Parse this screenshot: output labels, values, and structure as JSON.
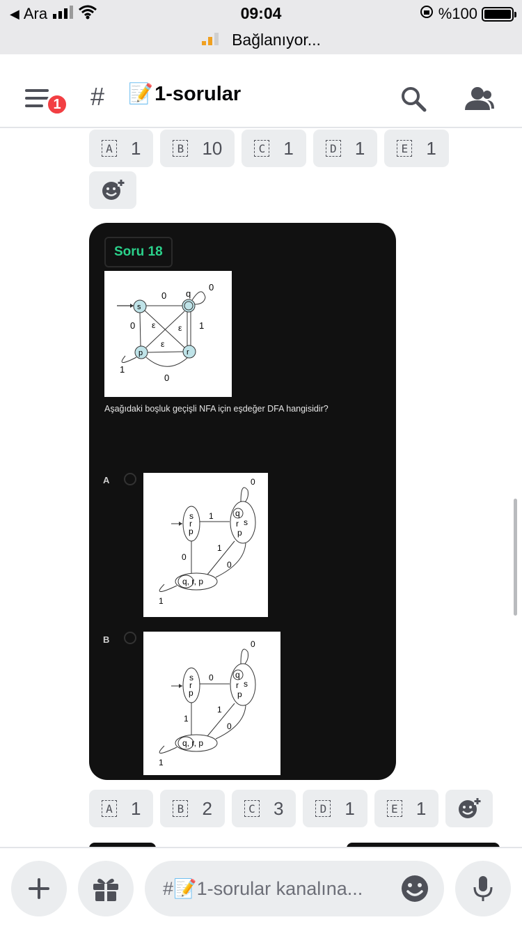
{
  "status": {
    "back_label": "Ara",
    "time": "09:04",
    "battery_text": "%100",
    "connecting_text": "Bağlanıyor..."
  },
  "header": {
    "badge_count": "1",
    "hash": "#",
    "channel_emoji": "📝",
    "channel_name": "1-sorular"
  },
  "reactions_top": [
    {
      "letter": "A",
      "count": "1"
    },
    {
      "letter": "B",
      "count": "10"
    },
    {
      "letter": "C",
      "count": "1"
    },
    {
      "letter": "D",
      "count": "1"
    },
    {
      "letter": "E",
      "count": "1"
    }
  ],
  "question": {
    "tag": "Soru 18",
    "text": "Aşağıdaki boşluk geçişli NFA için eşdeğer DFA hangisidir?",
    "option_a_label": "A",
    "option_b_label": "B",
    "nfa": {
      "s": "s",
      "q": "q",
      "r": "r",
      "p": "p",
      "zero": "0",
      "one": "1",
      "eps": "ε"
    },
    "opt_a": {
      "state1": [
        "s",
        "r",
        "p"
      ],
      "state2": [
        "q",
        "r",
        "s",
        "p"
      ],
      "state3": "q, r, p",
      "l1": "1",
      "l0a": "0",
      "l1b": "1",
      "l0b": "0",
      "loop0": "0",
      "loop1": "1"
    },
    "opt_b": {
      "state1": [
        "s",
        "r",
        "p"
      ],
      "state2": [
        "q",
        "r",
        "s",
        "p"
      ],
      "state3": "q, r, p",
      "l1": "0",
      "l0a": "1",
      "l1b": "1",
      "l0b": "0",
      "loop0": "0",
      "loop1": "1"
    }
  },
  "reactions_bottom": [
    {
      "letter": "A",
      "count": "1"
    },
    {
      "letter": "B",
      "count": "2"
    },
    {
      "letter": "C",
      "count": "3"
    },
    {
      "letter": "D",
      "count": "1"
    },
    {
      "letter": "E",
      "count": "1"
    }
  ],
  "composer": {
    "placeholder": "#📝1-sorular kanalına..."
  }
}
